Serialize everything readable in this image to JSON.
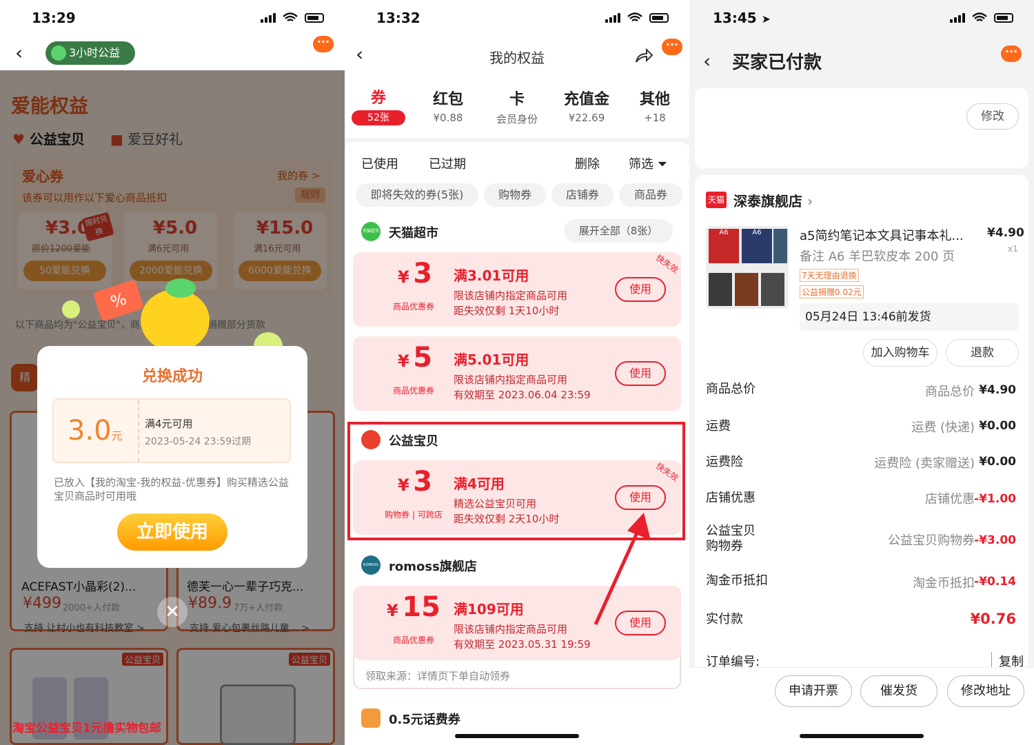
{
  "p1": {
    "time": "13:29",
    "badge": "3小时公益",
    "heading": "爱能权益",
    "tab1": "公益宝贝",
    "tab2": "爱豆好礼",
    "section": "爱心券",
    "my_coupons": "我的券 >",
    "rules": "规则",
    "desc": "该券可以用作以下爱心商品抵扣",
    "coupons": [
      {
        "amount": "¥3.0",
        "sub": "原价1200爱能",
        "tag": "限时兑换",
        "btn": "50爱能兑换"
      },
      {
        "amount": "¥5.0",
        "sub": "满6元可用",
        "btn": "2000爱能兑换"
      },
      {
        "amount": "¥15.0",
        "sub": "满16元可用",
        "btn": "6000爱能兑换"
      }
    ],
    "below_text": "以下商品均为\"公益宝贝\"，商家将向指定项目捐赠部分货款",
    "percent": "%",
    "modal": {
      "title": "兑换成功",
      "value": "3.0",
      "unit": "元",
      "cond": "满4元可用",
      "expire": "2023-05-24 23:59过期",
      "note": "已放入【我的淘宝-我的权益-优惠券】购买精选公益宝贝商品时可用哦",
      "use": "立即使用"
    },
    "products": [
      {
        "name": "ACEFAST小晶彩(2)...",
        "price": "¥499",
        "buyers": "2000+人付款",
        "support": "支持 让村小也有科技教室 >"
      },
      {
        "name": "德芙一心一辈子巧克...",
        "price": "¥89.9",
        "buyers": "7万+人付款",
        "support": "支持 爱心包裹丝路儿童... >"
      }
    ],
    "watermark": "淘宝公益宝贝1元撸实物包邮",
    "badge_gy": "公益宝贝",
    "jing": "精"
  },
  "p2": {
    "time": "13:32",
    "title": "我的权益",
    "tabs": [
      {
        "title": "券",
        "sub": "52张"
      },
      {
        "title": "红包",
        "sub": "¥0.88"
      },
      {
        "title": "卡",
        "sub": "会员身份"
      },
      {
        "title": "充值金",
        "sub": "¥22.69"
      },
      {
        "title": "其他",
        "sub": "+18"
      }
    ],
    "used": "已使用",
    "expired": "已过期",
    "delete": "删除",
    "filter": "筛选",
    "chips": [
      "即将失效的券(5张)",
      "购物券",
      "店铺券",
      "商品券"
    ],
    "shops": [
      {
        "name": "天猫超市",
        "expand": "展开全部（8张）"
      },
      {
        "name": "公益宝贝"
      },
      {
        "name": "romoss旗舰店"
      },
      {
        "name": "0.5元话费券"
      }
    ],
    "coupons": [
      {
        "yen": "¥",
        "num": "3",
        "label": "商品优惠券",
        "cond": "满3.01可用",
        "l1": "限该店铺内指定商品可用",
        "l2": "距失效仅剩 1天10小时",
        "btn": "使用",
        "flag": "快失效"
      },
      {
        "yen": "¥",
        "num": "5",
        "label": "商品优惠券",
        "cond": "满5.01可用",
        "l1": "限该店铺内指定商品可用",
        "l2": "有效期至 2023.06.04 23:59",
        "btn": "使用"
      },
      {
        "yen": "¥",
        "num": "3",
        "label": "购物券 | 可跨店",
        "cond": "满4可用",
        "l1": "精选公益宝贝可用",
        "l2": "距失效仅剩 2天10小时",
        "btn": "使用",
        "flag": "快失效"
      },
      {
        "yen": "¥",
        "num": "15",
        "label": "商品优惠券",
        "cond": "满109可用",
        "l1": "限该店铺内指定商品可用",
        "l2": "有效期至 2023.05.31 19:59",
        "btn": "使用"
      }
    ],
    "source": "领取来源：详情页下单自动领券",
    "tmall_logo": "天猫超市",
    "romoss_logo": "ROMOSS"
  },
  "p3": {
    "time": "13:45",
    "title": "买家已付款",
    "edit": "修改",
    "shop": "深泰旗舰店",
    "tmall": "天猫",
    "product": "a5简约笔记本文具记事本礼...",
    "spec": "备注 A6 羊巴软皮本 200 页",
    "tag1": "7天无理由退换",
    "tag2": "公益捐赠0.02元",
    "price": "¥4.90",
    "qty": "x1",
    "ship": "05月24日 13:46前发货",
    "cart": "加入购物车",
    "refund": "退款",
    "rows": [
      {
        "label": "商品总价",
        "mid": "商品总价",
        "val": "¥4.90"
      },
      {
        "label": "运费",
        "mid": "运费 (快递)",
        "val": "¥0.00"
      },
      {
        "label": "运费险",
        "mid": "运费险 (卖家赠送)",
        "val": "¥0.00"
      },
      {
        "label": "店铺优惠",
        "mid": "店铺优惠",
        "val": "-¥1.00"
      },
      {
        "label": "公益宝贝\n购物券",
        "mid": "公益宝贝购物券",
        "val": "-¥3.00"
      },
      {
        "label": "淘金币抵扣",
        "mid": "淘金币抵扣",
        "val": "-¥0.14"
      },
      {
        "label": "实付款",
        "mid": "",
        "val": "¥0.76"
      }
    ],
    "order_no": "订单编号:",
    "copy": "复制",
    "buttons": [
      "申请开票",
      "催发货",
      "修改地址"
    ],
    "a6": "A6"
  }
}
